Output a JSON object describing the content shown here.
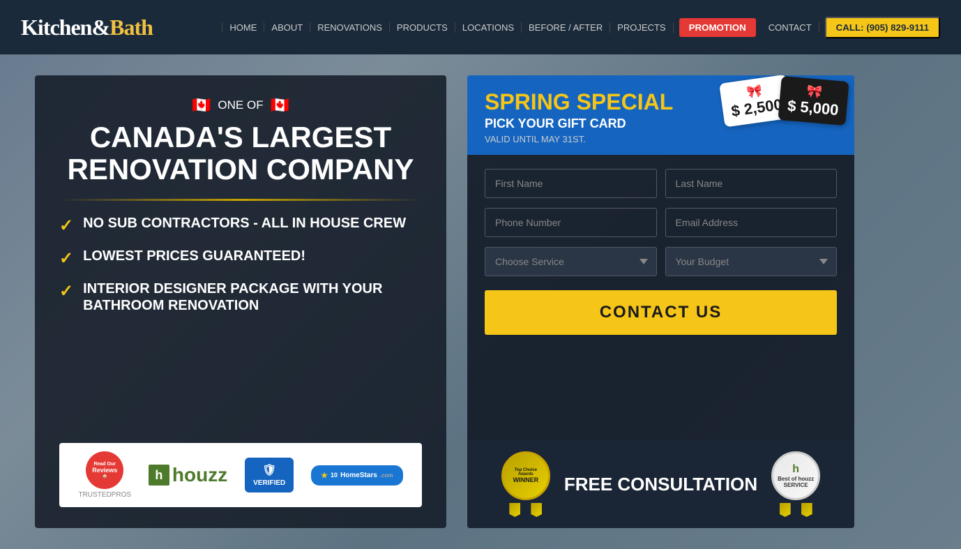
{
  "nav": {
    "logo": "Kitchen&Bath",
    "links": [
      "HOME",
      "ABOUT",
      "RENOVATIONS",
      "PRODUCTS",
      "LOCATIONS",
      "BEFORE / AFTER",
      "PROJECTS"
    ],
    "promo_label": "PROMOTION",
    "contact_label": "CONTACT",
    "call_label": "CALL: (905) 829-9111"
  },
  "left": {
    "one_of": "ONE OF",
    "title_line1": "CANADA'S LARGEST",
    "title_line2": "RENOVATION COMPANY",
    "features": [
      "NO SUB CONTRACTORS - ALL IN HOUSE CREW",
      "LOWEST PRICES GUARANTEED!",
      "INTERIOR DESIGNER PACKAGE WITH YOUR BATHROOM RENOVATION"
    ],
    "badges": {
      "trustedpros": "TRUSTEDPROS",
      "read": "Read Our",
      "reviews": "Reviews",
      "houzz": "houzz",
      "homestars_verified": "VERIFIED",
      "homestars": "HomeStars"
    }
  },
  "right": {
    "spring_special": "SPRING SPECIAL",
    "pick_gift": "PICK YOUR GIFT CARD",
    "valid_until": "VALID UNTIL MAY 31st.",
    "gift_card_1": "$ 2,500",
    "gift_card_2": "$ 5,000",
    "form": {
      "first_name_placeholder": "First Name",
      "last_name_placeholder": "Last Name",
      "phone_placeholder": "Phone Number",
      "email_placeholder": "Email Address",
      "service_placeholder": "Choose Service",
      "budget_placeholder": "Your Budget"
    },
    "contact_btn": "CONTACT US",
    "free_consultation": "FREE CONSULTATION",
    "award": {
      "top_choice": "Top Choice Awards",
      "winner": "WINNER"
    },
    "houzz_service": "Best of houzz SERVICE"
  }
}
